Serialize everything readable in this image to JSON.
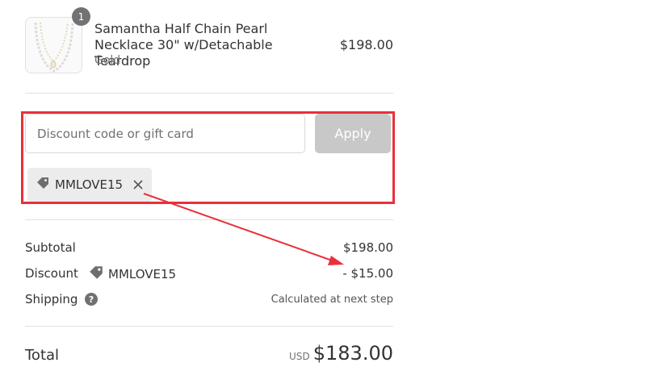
{
  "product": {
    "quantity": "1",
    "name": "Samantha Half Chain Pearl Necklace 30\" w/Detachable Teardrop",
    "variant": "Gold",
    "price": "$198.00",
    "image_icon": "pearl-necklace-image"
  },
  "discount": {
    "placeholder": "Discount code or gift card",
    "value": "",
    "apply_label": "Apply",
    "applied_code": "MMLOVE15",
    "tag_icon": "tag-icon",
    "remove_icon": "close-icon"
  },
  "summary": {
    "subtotal_label": "Subtotal",
    "subtotal_value": "$198.00",
    "discount_label": "Discount",
    "discount_code": "MMLOVE15",
    "discount_value": "- $15.00",
    "shipping_label": "Shipping",
    "shipping_value": "Calculated at next step",
    "total_label": "Total",
    "currency": "USD",
    "total_value": "$183.00"
  },
  "annotation": {
    "highlight_color": "#e8303a"
  },
  "colors": {
    "apply_button_bg": "#c8c8c8",
    "tag_bg": "#ececec"
  }
}
